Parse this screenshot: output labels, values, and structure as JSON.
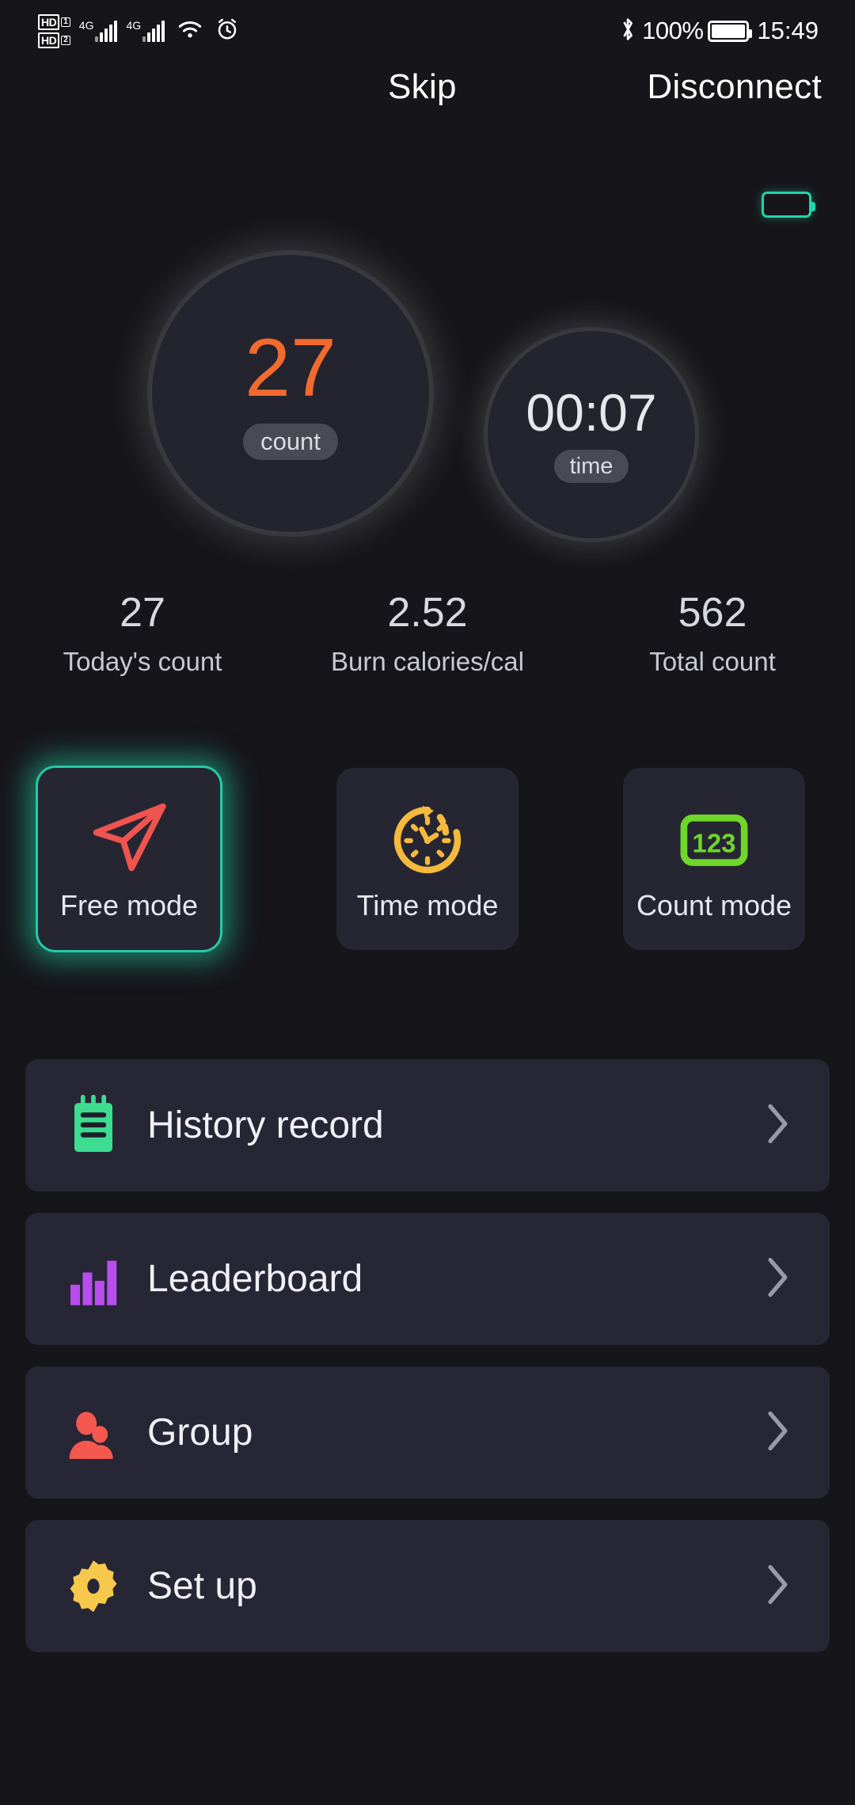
{
  "statusbar": {
    "hd1_label": "HD",
    "hd1_sim": "1",
    "hd2_label": "HD",
    "hd2_sim": "2",
    "net1": "4G",
    "net2": "4G",
    "wifi_icon": "wifi-icon",
    "alarm_icon": "alarm-icon",
    "bluetooth_icon": "bluetooth-icon",
    "battery_percent": "100%",
    "clock": "15:49"
  },
  "header": {
    "skip_label": "Skip",
    "disconnect_label": "Disconnect"
  },
  "device": {
    "battery_icon": "device-battery-icon",
    "battery_color": "#25d3aa"
  },
  "counters": {
    "count": {
      "value": "27",
      "badge": "count",
      "color": "#f26a2e"
    },
    "time": {
      "value": "00:07",
      "badge": "time",
      "color": "#e6e6ec"
    }
  },
  "stats": [
    {
      "value": "27",
      "label": "Today's count"
    },
    {
      "value": "2.52",
      "label": "Burn calories/cal"
    },
    {
      "value": "562",
      "label": "Total count"
    }
  ],
  "modes": [
    {
      "label": "Free mode",
      "icon": "paper-plane-icon",
      "color": "#f0544f",
      "active": true
    },
    {
      "label": "Time mode",
      "icon": "clock-arrow-icon",
      "color": "#f5b93e",
      "active": false
    },
    {
      "label": "Count mode",
      "icon": "numbers-123-icon",
      "color": "#6fd62a",
      "active": false
    }
  ],
  "menu": [
    {
      "label": "History record",
      "icon": "notepad-icon",
      "color": "#3ddc91"
    },
    {
      "label": "Leaderboard",
      "icon": "bar-chart-icon",
      "color": "#b84df0"
    },
    {
      "label": "Group",
      "icon": "people-icon",
      "color": "#f4584f"
    },
    {
      "label": "Set up",
      "icon": "gear-icon",
      "color": "#f6c council"
    }
  ],
  "chevron_icon": "chevron-right-icon"
}
